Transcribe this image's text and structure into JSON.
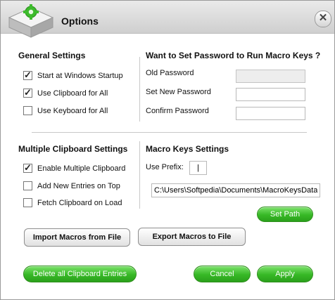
{
  "window": {
    "title": "Options",
    "close_glyph": "✕"
  },
  "icons": {
    "app": "gear-cube-icon",
    "close": "close-icon"
  },
  "colors": {
    "accent_green": "#37b826",
    "title_bar": "#d8d8d8"
  },
  "general": {
    "title": "General Settings",
    "items": [
      {
        "label": "Start at Windows Startup",
        "checked": true
      },
      {
        "label": "Use Clipboard for All",
        "checked": true
      },
      {
        "label": "Use Keyboard for All",
        "checked": false
      }
    ]
  },
  "password": {
    "title": "Want to Set Password to Run Macro Keys ?",
    "old_label": "Old Password",
    "new_label": "Set New Password",
    "confirm_label": "Confirm Password",
    "old_value": "",
    "new_value": "",
    "confirm_value": ""
  },
  "clipboard": {
    "title": "Multiple Clipboard Settings",
    "items": [
      {
        "label": "Enable Multiple Clipboard",
        "checked": true
      },
      {
        "label": "Add New Entries on Top",
        "checked": false
      },
      {
        "label": "Fetch Clipboard on Load",
        "checked": false
      }
    ]
  },
  "macro": {
    "title": "Macro Keys Settings",
    "prefix_label": "Use Prefix:",
    "prefix_value": "|",
    "path_value": "C:\\Users\\Softpedia\\Documents\\MacroKeysData\\",
    "set_path_label": "Set Path"
  },
  "buttons": {
    "import": "Import Macros from File",
    "export": "Export Macros to File",
    "delete_all": "Delete all Clipboard Entries",
    "cancel": "Cancel",
    "apply": "Apply"
  }
}
